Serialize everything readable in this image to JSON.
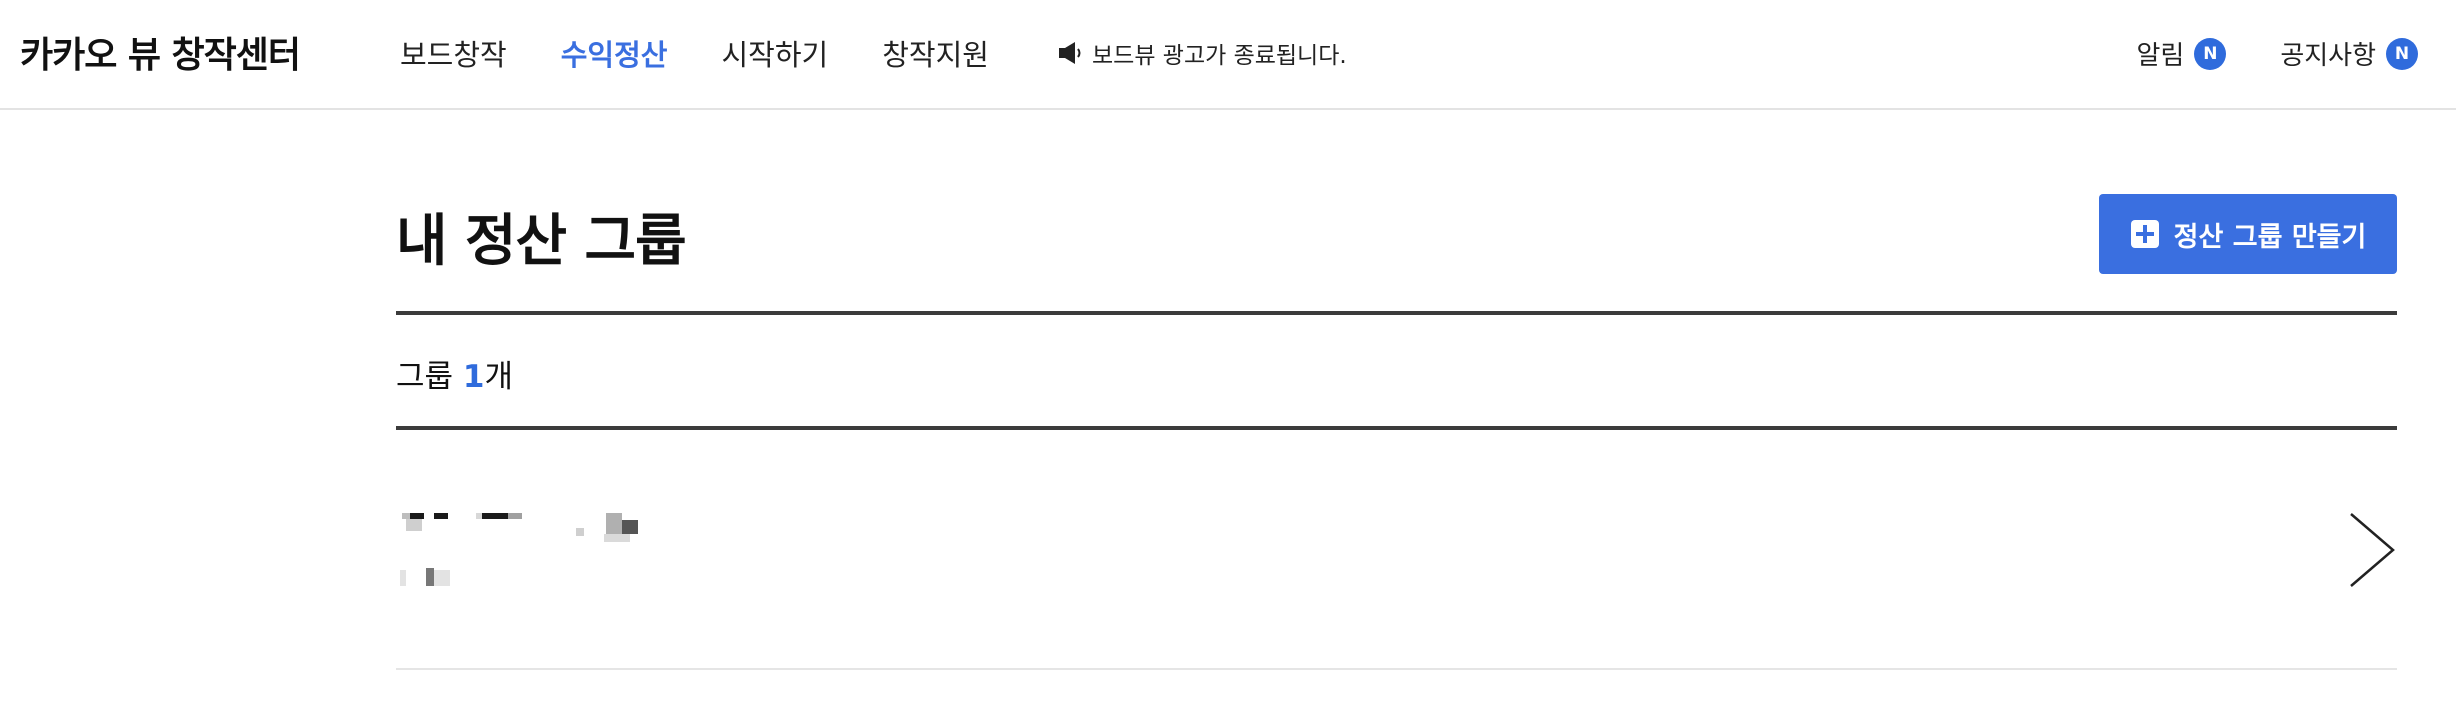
{
  "header": {
    "logo": "카카오 뷰 창작센터",
    "nav": [
      {
        "label": "보드창작",
        "active": false
      },
      {
        "label": "수익정산",
        "active": true
      },
      {
        "label": "시작하기",
        "active": false
      },
      {
        "label": "창작지원",
        "active": false
      }
    ],
    "notice": {
      "icon": "speaker-icon",
      "text": "보드뷰 광고가 종료됩니다."
    },
    "right": {
      "alerts": {
        "label": "알림",
        "badge": "N"
      },
      "announcements": {
        "label": "공지사항",
        "badge": "N"
      }
    }
  },
  "main": {
    "title": "내 정산 그룹",
    "create_button": {
      "label": "정산 그룹 만들기",
      "icon": "plus-square-icon"
    },
    "group_count": {
      "prefix": "그룹 ",
      "count": "1",
      "suffix": "개"
    },
    "groups": [
      {
        "name_redacted": true,
        "icon": "chevron-right-icon"
      }
    ]
  },
  "colors": {
    "accent": "#3a6fe0",
    "badge": "#2f6bdc",
    "divider_dark": "#3b3b3b",
    "divider_light": "#e5e5e5"
  }
}
